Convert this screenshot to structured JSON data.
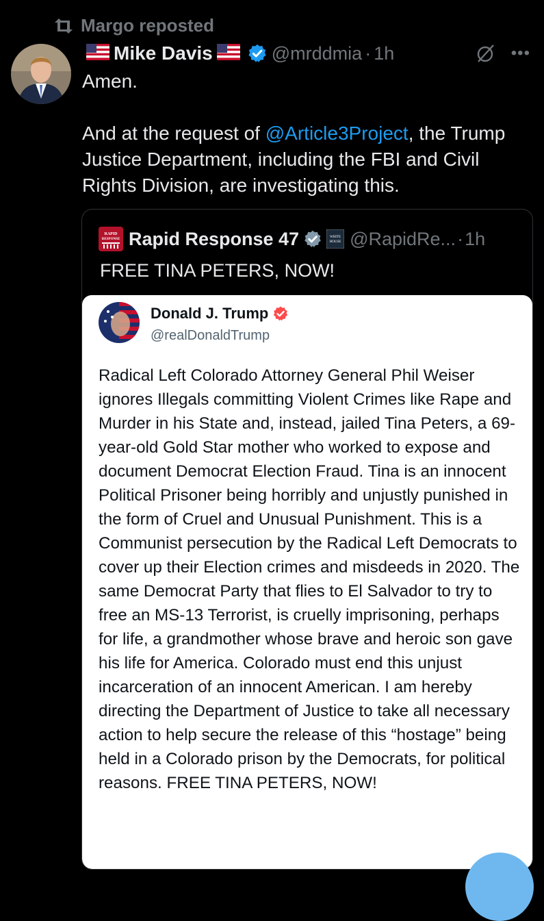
{
  "repost": {
    "text": "Margo reposted"
  },
  "tweet": {
    "author_name": "Mike Davis",
    "handle": "@mrddmia",
    "time": "1h",
    "line1": "Amen.",
    "line2_prefix": "And at the request of ",
    "mention": "@Article3Project",
    "line2_suffix": ", the Trump Justice Department, including the FBI and Civil Rights Division, are investigating this."
  },
  "quote": {
    "author_name": "Rapid Response 47",
    "handle": "@RapidRe...",
    "time": "1h",
    "text": "FREE TINA PETERS, NOW!",
    "logo_text": "RAPID RESPONSE",
    "affiliate_badge_text": "WHITE HOUSE"
  },
  "embedded_post": {
    "author_name": "Donald J. Trump",
    "handle": "@realDonaldTrump",
    "text": "Radical Left Colorado Attorney General Phil Weiser ignores Illegals committing Violent Crimes like Rape and Murder in his State and, instead, jailed Tina Peters, a 69-year-old Gold Star mother who worked to expose and document Democrat Election Fraud. Tina is an innocent Political Prisoner being horribly and unjustly punished in the form of Cruel and Unusual Punishment. This is a Communist persecution by the Radical Left Democrats to cover up their Election crimes and misdeeds in 2020. The same Democrat Party that flies to El Salvador to try to free an MS-13 Terrorist, is cruelly imprisoning, perhaps for life, a grandmother whose brave and heroic son gave his life for America. Colorado must end this unjust incarceration of an innocent American. I am hereby directing the Department of Justice to take all necessary action to help secure the release of this “hostage” being held in a Colorado prison by the Democrats, for political reasons. FREE TINA PETERS, NOW!"
  },
  "colors": {
    "background": "#000000",
    "text": "#e7e9ea",
    "muted": "#71767b",
    "accent": "#1d9bf0",
    "verified_gray": "#829aab",
    "truth_badge": "#ff4b4b"
  },
  "icons": {
    "repost": "repost-icon",
    "verified": "verified-badge-icon",
    "grok": "grok-icon",
    "more": "more-icon"
  }
}
